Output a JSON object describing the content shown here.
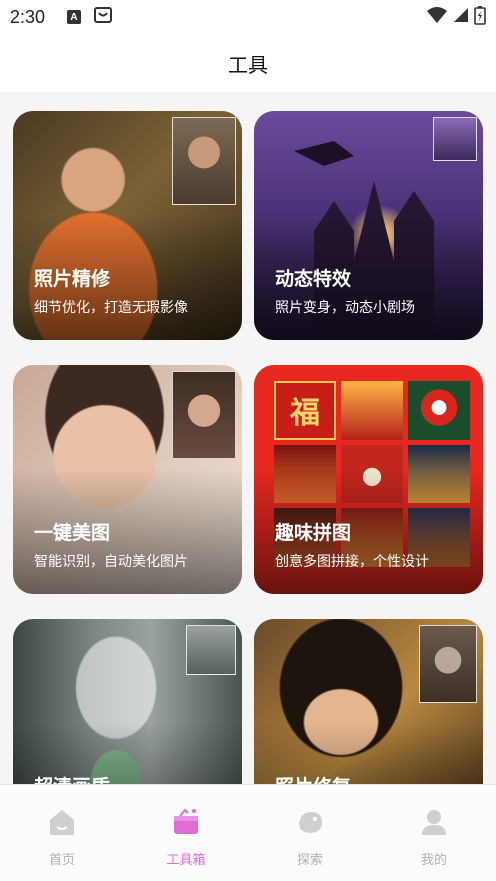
{
  "status_bar": {
    "time": "2:30",
    "notif_a": "A"
  },
  "header": {
    "title": "工具"
  },
  "cards": [
    {
      "title": "照片精修",
      "subtitle": "细节优化，打造无瑕影像"
    },
    {
      "title": "动态特效",
      "subtitle": "照片变身，动态小剧场"
    },
    {
      "title": "一键美图",
      "subtitle": "智能识别，自动美化图片"
    },
    {
      "title": "趣味拼图",
      "subtitle": "创意多图拼接，个性设计"
    },
    {
      "title": "超清画质",
      "subtitle": ""
    },
    {
      "title": "照片修复",
      "subtitle": ""
    }
  ],
  "collage_glyph": "福",
  "tabs": [
    {
      "label": "首页",
      "icon": "home-icon"
    },
    {
      "label": "工具箱",
      "icon": "toolbox-icon"
    },
    {
      "label": "探索",
      "icon": "explore-icon"
    },
    {
      "label": "我的",
      "icon": "profile-icon"
    }
  ],
  "colors": {
    "accent": "#e26bd8",
    "inactive": "#b0b0b0",
    "collage_red": "#e8281f"
  }
}
